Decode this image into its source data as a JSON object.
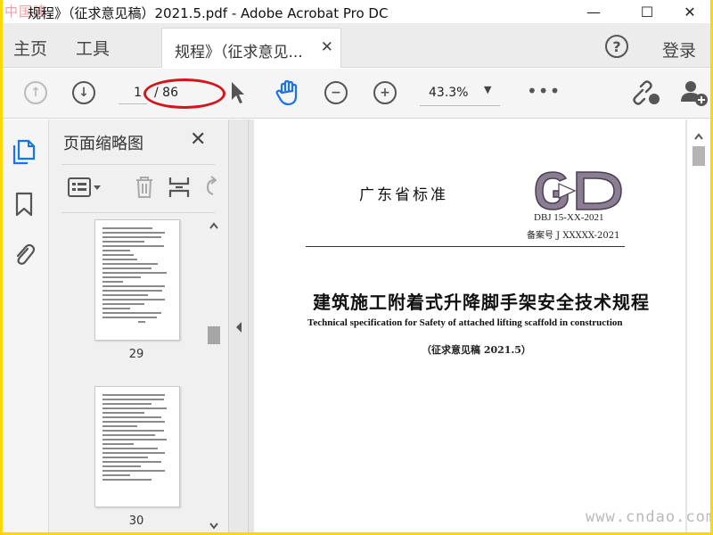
{
  "watermark_top": "中国建",
  "window": {
    "title": "规程》（征求意见稿）2021.5.pdf - Adobe Acrobat Pro DC",
    "minimize": "—",
    "maximize": "☐",
    "close": "✕"
  },
  "menu": {
    "home": "主页",
    "tools": "工具",
    "doc_tab": "规程》（征求意见...",
    "doc_tab_close": "✕",
    "help": "?",
    "login": "登录"
  },
  "toolbar": {
    "prev_page": "↑",
    "next_page": "↓",
    "current_page": "1",
    "total_pages": "/ 86",
    "zoom": "43.3%",
    "zoom_caret": "▼",
    "more": "•••",
    "zoom_out": "−",
    "zoom_in": "+"
  },
  "sidebar": {
    "panel_title": "页面缩略图",
    "panel_close": "✕",
    "thumbnails": [
      {
        "label": "29"
      },
      {
        "label": "30"
      }
    ]
  },
  "document": {
    "standard_name": "广东省标准",
    "logo_text": "GD",
    "code": "DBJ 15-XX-2021",
    "record": "备案号 J XXXXX-2021",
    "title_cn": "建筑施工附着式升降脚手架安全技术规程",
    "title_en": "Technical specification for Safety of attached lifting scaffold in construction",
    "draft": "（征求意见稿 2021.5）"
  },
  "watermark_bottom": "www.cndao.com",
  "colors": {
    "frame": "#ffd800",
    "accent_blue": "#1b73e8",
    "annotation_red": "#d4151b"
  }
}
